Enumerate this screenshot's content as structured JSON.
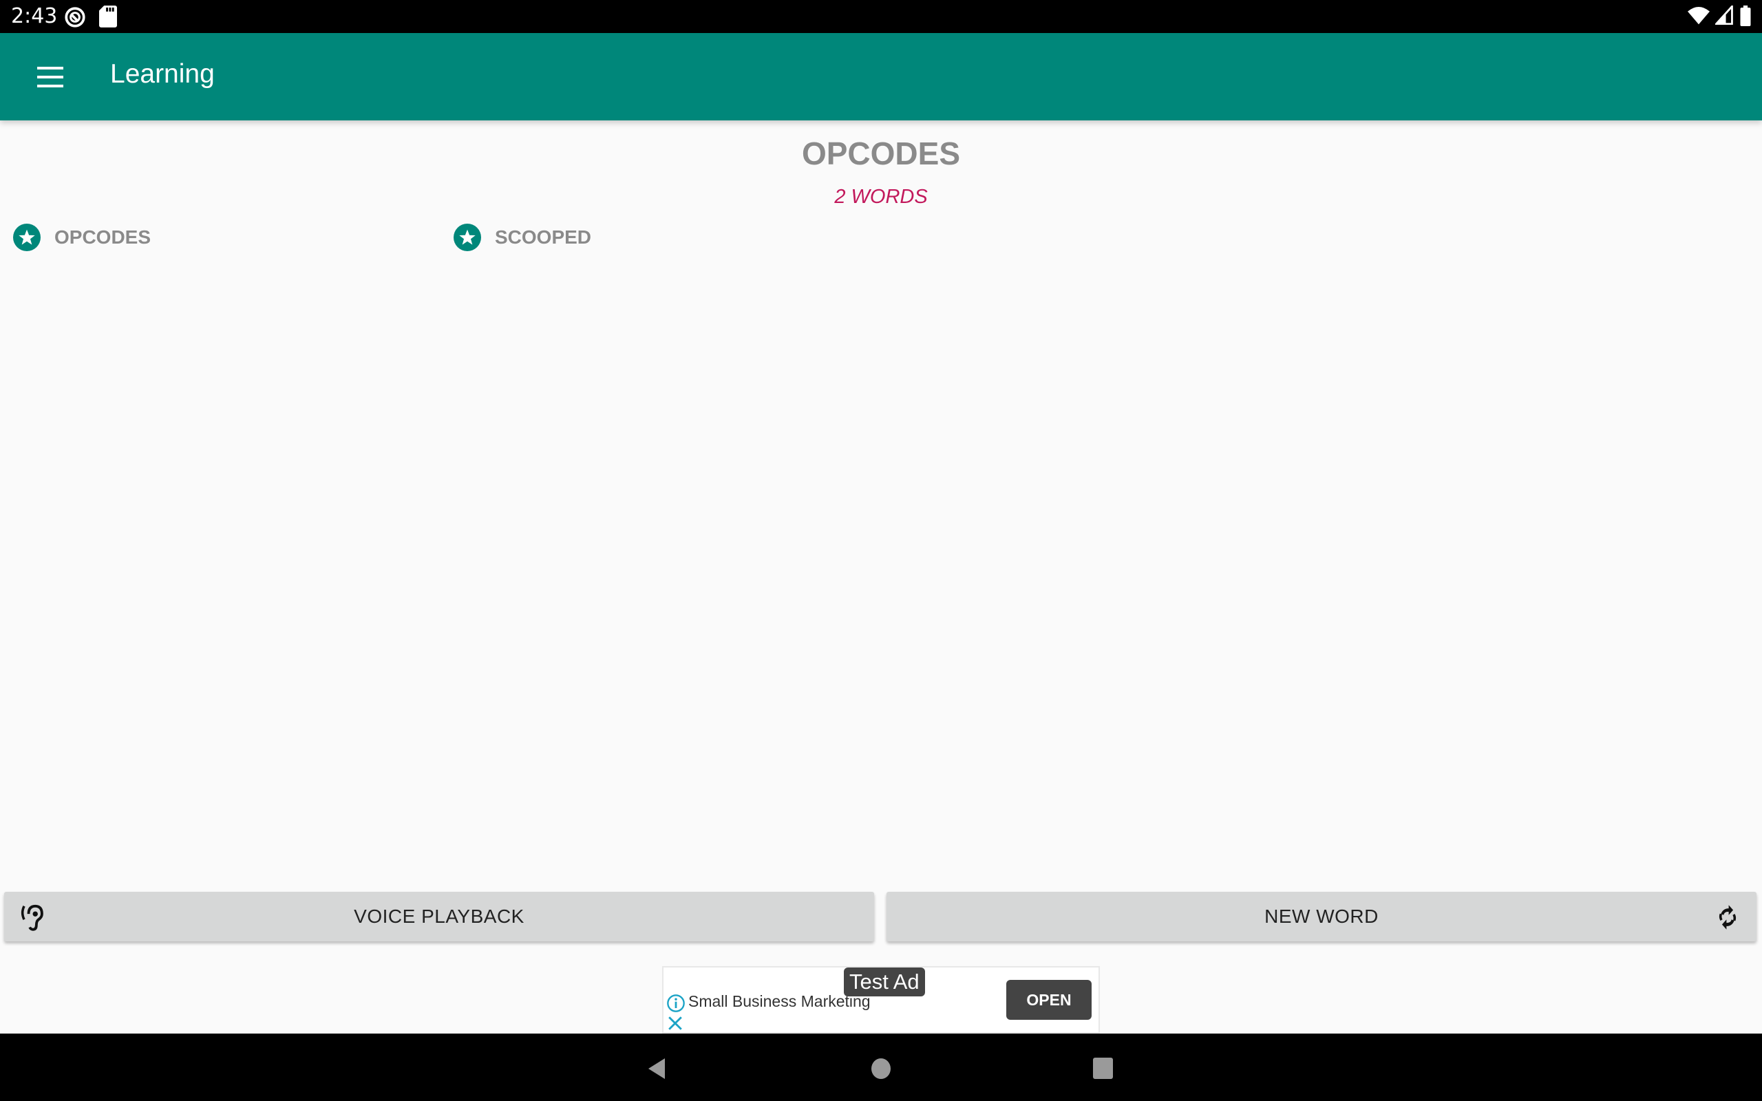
{
  "status_bar": {
    "time": "2:43",
    "left_icons": [
      "data-saver-icon",
      "sd-card-icon"
    ],
    "right_icons": [
      "wifi-icon",
      "cell-signal-icon",
      "battery-icon"
    ]
  },
  "toolbar": {
    "menu_icon": "hamburger-menu-icon",
    "title": "Learning",
    "color": "#00877a"
  },
  "main": {
    "title": "OPCODES",
    "word_count": "2 WORDS",
    "word_count_color": "#c2185b",
    "words": [
      {
        "label": "OPCODES",
        "icon": "star-badge-icon"
      },
      {
        "label": "SCOOPED",
        "icon": "star-badge-icon"
      }
    ]
  },
  "actions": {
    "voice_playback": {
      "label": "VOICE PLAYBACK",
      "icon": "ear-icon"
    },
    "new_word": {
      "label": "NEW WORD",
      "icon": "refresh-icon"
    }
  },
  "ad": {
    "tag": "Test Ad",
    "headline": "Small Business Marketing",
    "cta": "OPEN",
    "info_icon": "info-icon",
    "close_icon": "close-icon"
  },
  "nav_bar": {
    "buttons": [
      "back-icon",
      "home-icon",
      "recents-icon"
    ]
  }
}
